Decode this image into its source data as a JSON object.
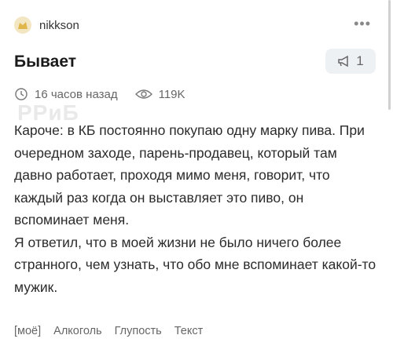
{
  "post": {
    "author": "nikkson",
    "more_label": "•••",
    "title": "Бывает",
    "vote_count": "1",
    "time_ago": "16 часов назад",
    "views": "119K",
    "watermark": "РРиБ",
    "paragraphs": [
      "Кароче: в КБ постоянно покупаю одну марку пива. При очередном заходе, парень-продавец, который там давно работает, проходя мимо меня, говорит, что каждый раз когда он выставляет это пиво, он вспоминает меня.",
      "Я ответил, что в моей жизни не было ничего более странного, чем узнать, что обо мне вспоминает какой-то мужик."
    ],
    "tags": [
      "[моё]",
      "Алкоголь",
      "Глупость",
      "Текст"
    ]
  },
  "icons": {
    "avatar": "avatar-icon",
    "vote": "megaphone-icon",
    "time": "clock-icon",
    "views": "eye-icon"
  }
}
